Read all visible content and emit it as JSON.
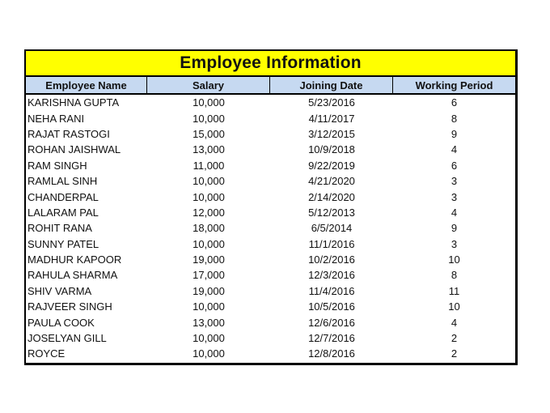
{
  "table": {
    "title": "Employee Information",
    "columns": [
      "Employee Name",
      "Salary",
      "Joining Date",
      "Working Period"
    ],
    "rows": [
      [
        "KARISHNA GUPTA",
        "10,000",
        "5/23/2016",
        "6"
      ],
      [
        "NEHA RANI",
        "10,000",
        "4/11/2017",
        "8"
      ],
      [
        "RAJAT RASTOGI",
        "15,000",
        "3/12/2015",
        "9"
      ],
      [
        "ROHAN JAISHWAL",
        "13,000",
        "10/9/2018",
        "4"
      ],
      [
        "RAM SINGH",
        "11,000",
        "9/22/2019",
        "6"
      ],
      [
        "RAMLAL SINH",
        "10,000",
        "4/21/2020",
        "3"
      ],
      [
        "CHANDERPAL",
        "10,000",
        "2/14/2020",
        "3"
      ],
      [
        "LALARAM PAL",
        "12,000",
        "5/12/2013",
        "4"
      ],
      [
        "ROHIT RANA",
        "18,000",
        "6/5/2014",
        "9"
      ],
      [
        "SUNNY PATEL",
        "10,000",
        "11/1/2016",
        "3"
      ],
      [
        "MADHUR KAPOOR",
        "19,000",
        "10/2/2016",
        "10"
      ],
      [
        "RAHULA SHARMA",
        "17,000",
        "12/3/2016",
        "8"
      ],
      [
        "SHIV VARMA",
        "19,000",
        "11/4/2016",
        "11"
      ],
      [
        "RAJVEER SINGH",
        "10,000",
        "10/5/2016",
        "10"
      ],
      [
        "PAULA COOK",
        "13,000",
        "12/6/2016",
        "4"
      ],
      [
        "JOSELYAN GILL",
        "10,000",
        "12/7/2016",
        "2"
      ],
      [
        "ROYCE",
        "10,000",
        "12/8/2016",
        "2"
      ]
    ]
  },
  "colors": {
    "title_background": "#ffff00",
    "header_background": "#c6d9f1",
    "border": "#000000"
  }
}
